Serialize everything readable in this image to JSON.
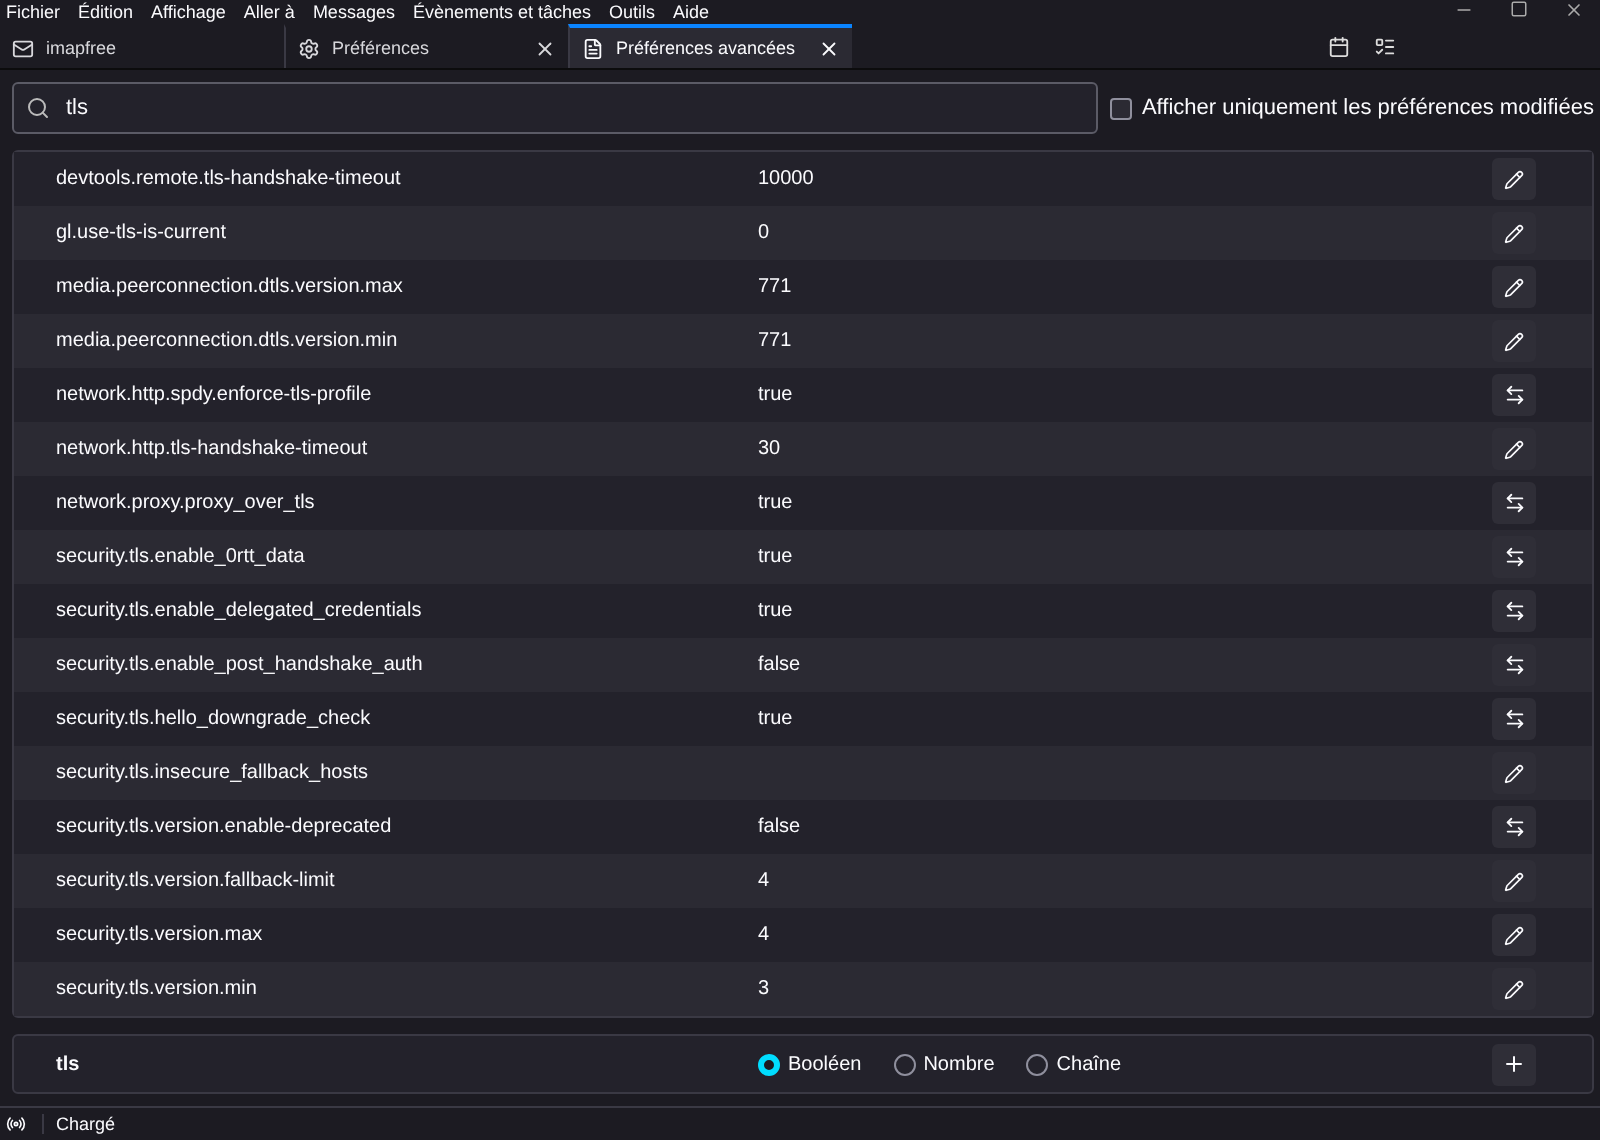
{
  "menu": [
    "Fichier",
    "Édition",
    "Affichage",
    "Aller à",
    "Messages",
    "Évènements et tâches",
    "Outils",
    "Aide"
  ],
  "tabs": [
    {
      "label": "imapfree",
      "kind": "mail",
      "selected": false,
      "closable": false
    },
    {
      "label": "Préférences",
      "kind": "gear",
      "selected": false,
      "closable": true
    },
    {
      "label": "Préférences avancées",
      "kind": "page",
      "selected": true,
      "closable": true
    }
  ],
  "search": {
    "value": "tls"
  },
  "modified_only": {
    "label": "Afficher uniquement les préférences modifiées",
    "checked": false
  },
  "prefs": [
    {
      "name": "devtools.remote.tls-handshake-timeout",
      "value": "10000",
      "kind": "edit"
    },
    {
      "name": "gl.use-tls-is-current",
      "value": "0",
      "kind": "edit"
    },
    {
      "name": "media.peerconnection.dtls.version.max",
      "value": "771",
      "kind": "edit"
    },
    {
      "name": "media.peerconnection.dtls.version.min",
      "value": "771",
      "kind": "edit"
    },
    {
      "name": "network.http.spdy.enforce-tls-profile",
      "value": "true",
      "kind": "toggle"
    },
    {
      "name": "network.http.tls-handshake-timeout",
      "value": "30",
      "kind": "edit"
    },
    {
      "name": "network.proxy.proxy_over_tls",
      "value": "true",
      "kind": "toggle"
    },
    {
      "name": "security.tls.enable_0rtt_data",
      "value": "true",
      "kind": "toggle"
    },
    {
      "name": "security.tls.enable_delegated_credentials",
      "value": "true",
      "kind": "toggle"
    },
    {
      "name": "security.tls.enable_post_handshake_auth",
      "value": "false",
      "kind": "toggle"
    },
    {
      "name": "security.tls.hello_downgrade_check",
      "value": "true",
      "kind": "toggle"
    },
    {
      "name": "security.tls.insecure_fallback_hosts",
      "kind": "edit"
    },
    {
      "name": "security.tls.version.enable-deprecated",
      "value": "false",
      "kind": "toggle"
    },
    {
      "name": "security.tls.version.fallback-limit",
      "value": "4",
      "kind": "edit"
    },
    {
      "name": "security.tls.version.max",
      "value": "4",
      "kind": "edit"
    },
    {
      "name": "security.tls.version.min",
      "value": "3",
      "kind": "edit"
    }
  ],
  "new_pref": {
    "name": "tls",
    "types": [
      {
        "label": "Booléen",
        "selected": true
      },
      {
        "label": "Nombre",
        "selected": false
      },
      {
        "label": "Chaîne",
        "selected": false
      }
    ]
  },
  "status": "Chargé"
}
